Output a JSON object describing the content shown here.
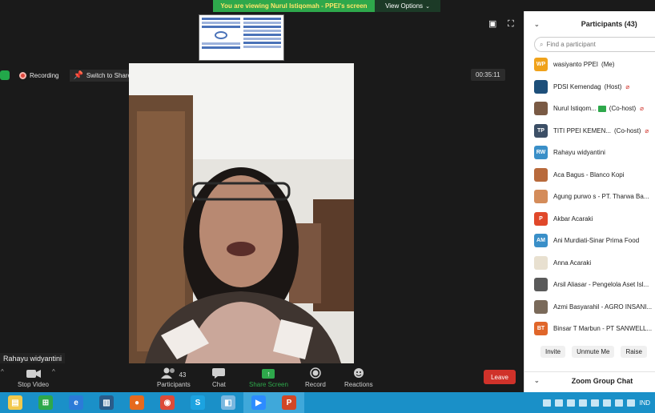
{
  "banner": {
    "text": "You are viewing Nurul Istiqomah - PPEI's screen",
    "view_options": "View Options"
  },
  "status": {
    "recording": "Recording",
    "switch": "Switch to Shared Content"
  },
  "timer": "00:35:11",
  "speaker_name": "Rahayu widyantini",
  "toolbar": {
    "stop_video": "Stop Video",
    "participants": "Participants",
    "participant_count": "43",
    "chat": "Chat",
    "share_screen": "Share Screen",
    "record": "Record",
    "reactions": "Reactions",
    "leave": "Leave"
  },
  "panel": {
    "title": "Participants (43)",
    "search_placeholder": "Find a participant",
    "participants": [
      {
        "initials": "WP",
        "color": "#f0a21b",
        "name": "wasiyanto PPEI",
        "status": "(Me)",
        "muted": false
      },
      {
        "initials": "",
        "color": "#1d4f7a",
        "name": "PDSI Kemendag",
        "status": "(Host)",
        "muted": true
      },
      {
        "initials": "",
        "color": "#7a5a44",
        "name": "Nurul Istiqom...",
        "status": "(Co-host)",
        "muted": true,
        "video": true
      },
      {
        "initials": "TP",
        "color": "#3c4f66",
        "name": "TITI PPEI KEMEN...",
        "status": "(Co-host)",
        "muted": true
      },
      {
        "initials": "RW",
        "color": "#3a8fc8",
        "name": "Rahayu widyantini",
        "status": "",
        "muted": false
      },
      {
        "initials": "",
        "color": "#b86a3c",
        "name": "Aca Bagus - Blanco Kopi",
        "status": "",
        "muted": false
      },
      {
        "initials": "",
        "color": "#d48c5a",
        "name": "Agung purwo s - PT. Tharwa Ba...",
        "status": "",
        "muted": false
      },
      {
        "initials": "P",
        "color": "#e0482a",
        "name": "Akbar Acaraki",
        "status": "",
        "muted": false
      },
      {
        "initials": "AM",
        "color": "#3a8fc8",
        "name": "Ani Murdiati-Sinar Prima Food",
        "status": "",
        "muted": false
      },
      {
        "initials": "",
        "color": "#e8e0d0",
        "name": "Anna Acaraki",
        "status": "",
        "muted": false
      },
      {
        "initials": "",
        "color": "#5a5a5a",
        "name": "Arsil Aliasar - Pengelola Aset Isl...",
        "status": "",
        "muted": false
      },
      {
        "initials": "",
        "color": "#7a6a5a",
        "name": "Azmi Basyarahil - AGRO INSANI...",
        "status": "",
        "muted": false
      },
      {
        "initials": "BT",
        "color": "#e0662a",
        "name": "Binsar T Marbun - PT SANWELL...",
        "status": "",
        "muted": false
      }
    ],
    "actions": [
      "Invite",
      "Unmute Me",
      "Raise"
    ],
    "chat_title": "Zoom Group Chat"
  },
  "taskbar": {
    "apps": [
      "file-explorer",
      "store",
      "internet-explorer",
      "notes",
      "firefox",
      "chrome",
      "skype",
      "paint",
      "zoom",
      "powerpoint"
    ],
    "language": "IND"
  }
}
